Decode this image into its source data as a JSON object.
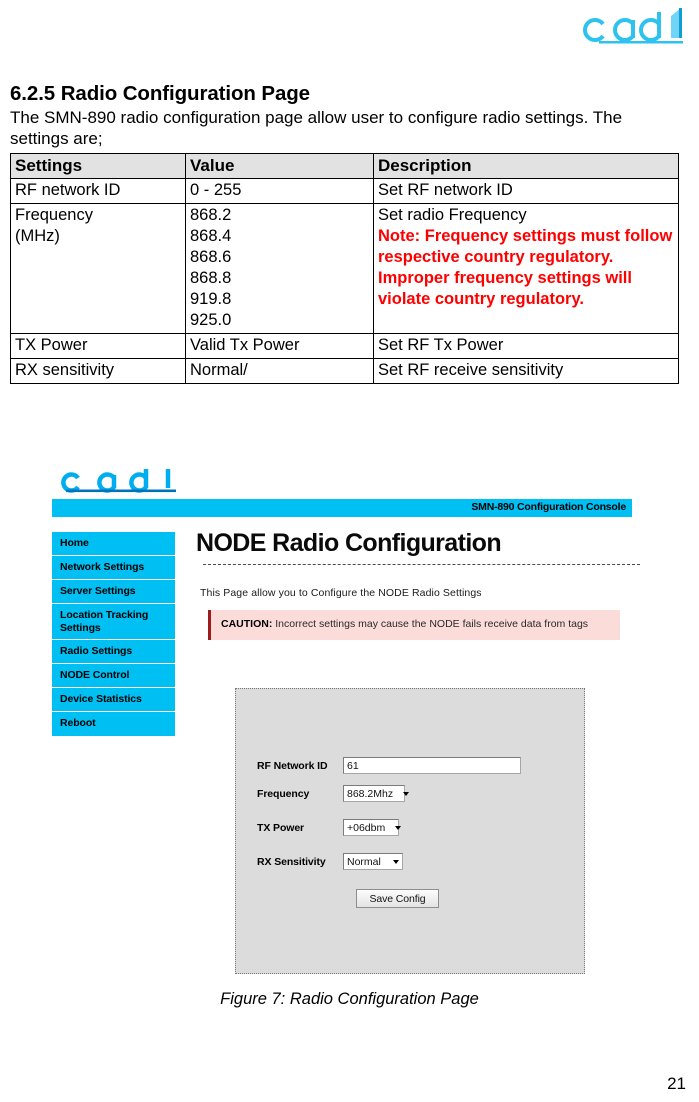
{
  "document": {
    "brand_logo": "cadl-logo",
    "section_number_title": "6.2.5 Radio Configuration Page",
    "intro": "The SMN-890 radio configuration page allow user to configure radio settings. The settings are;",
    "figure_caption": "Figure 7: Radio Configuration Page",
    "page_number": "21"
  },
  "settings_table": {
    "headers": [
      "Settings",
      "Value",
      "Description"
    ],
    "rows": [
      {
        "setting": "RF network ID",
        "value": "0 - 255",
        "description": "Set RF network ID",
        "note": ""
      },
      {
        "setting": "Frequency (MHz)",
        "setting_line1": "Frequency",
        "setting_line2": "(MHz)",
        "values": [
          "868.2",
          "868.4",
          "868.6",
          "868.8",
          "919.8",
          "925.0"
        ],
        "description": "Set radio Frequency",
        "note": "Note: Frequency settings must follow respective country regulatory. Improper frequency settings will violate country regulatory."
      },
      {
        "setting": "TX Power",
        "value": "Valid Tx Power",
        "description": "Set RF Tx Power",
        "note": ""
      },
      {
        "setting": "RX sensitivity",
        "value": "Normal/",
        "description": "Set RF receive sensitivity",
        "note": ""
      }
    ]
  },
  "screenshot": {
    "logo": "cadl-logo",
    "console_title": "SMN-890 Configuration Console",
    "sidebar": {
      "items": [
        {
          "label": "Home"
        },
        {
          "label": "Network Settings"
        },
        {
          "label": "Server Settings"
        },
        {
          "label": "Location Tracking Settings"
        },
        {
          "label": "Radio Settings"
        },
        {
          "label": "NODE Control"
        },
        {
          "label": "Device Statistics"
        },
        {
          "label": "Reboot"
        }
      ]
    },
    "main": {
      "heading": "NODE Radio Configuration",
      "subtitle": "This Page allow you to Configure the NODE Radio Settings",
      "caution": {
        "prefix": "CAUTION:",
        "text": " Incorrect settings may cause the NODE fails receive data from tags"
      },
      "form": {
        "rf_network_id": {
          "label": "RF Network ID",
          "value": "61"
        },
        "frequency": {
          "label": "Frequency",
          "value": "868.2Mhz"
        },
        "tx_power": {
          "label": "TX Power",
          "value": "+06dbm"
        },
        "rx_sensitivity": {
          "label": "RX Sensitivity",
          "value": "Normal"
        },
        "save_button": "Save Config"
      }
    }
  },
  "colors": {
    "accent_cyan": "#00bff3",
    "caution_bg": "#fbdcd8",
    "caution_border": "#9e1b1b",
    "panel_grey": "#dcdcdc",
    "note_red": "#ff0000",
    "table_header_grey": "#e2e2e2"
  }
}
